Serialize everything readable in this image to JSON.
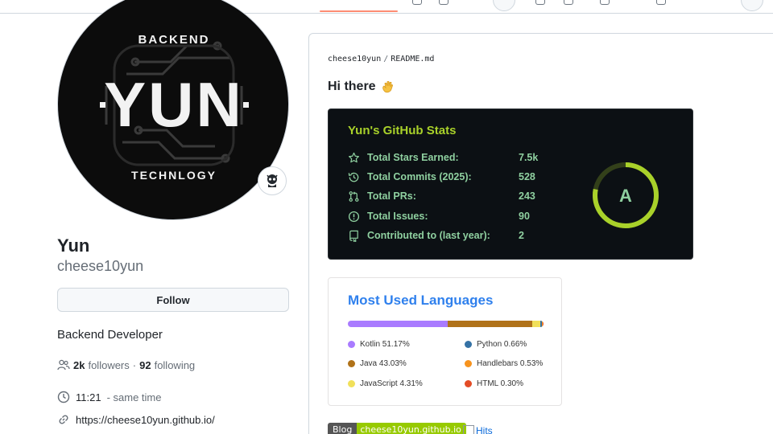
{
  "profile": {
    "display_name": "Yun",
    "login": "cheese10yun",
    "follow_label": "Follow",
    "bio": "Backend Developer",
    "followers_count": "2k",
    "followers_label": "followers",
    "separator": "·",
    "following_count": "92",
    "following_label": "following",
    "local_time": "11:21",
    "time_suffix": "- same time",
    "website": "https://cheese10yun.github.io/",
    "avatar_text": {
      "top": "BACKEND",
      "main": "YUN",
      "bottom": "TECHNLOGY"
    }
  },
  "readme": {
    "owner": "cheese10yun",
    "separator": "/",
    "file": "README.md",
    "greeting": "Hi there"
  },
  "stats": {
    "title": "Yun's GitHub Stats",
    "rows": [
      {
        "label": "Total Stars Earned:",
        "value": "7.5k",
        "icon": "star-icon"
      },
      {
        "label": "Total Commits (2025):",
        "value": "528",
        "icon": "history-icon"
      },
      {
        "label": "Total PRs:",
        "value": "243",
        "icon": "pull-request-icon"
      },
      {
        "label": "Total Issues:",
        "value": "90",
        "icon": "issue-icon"
      },
      {
        "label": "Contributed to (last year):",
        "value": "2",
        "icon": "repo-icon"
      }
    ],
    "rank": "A",
    "rank_progress": 0.78,
    "colors": {
      "title": "#a9d12a",
      "text": "#8fd0a0",
      "ring": "#a9d12a",
      "background": "#0c1014"
    }
  },
  "languages": {
    "title": "Most Used Languages",
    "items": [
      {
        "name": "Kotlin",
        "percent": 51.17,
        "label": "Kotlin 51.17%",
        "color": "#A97BFF"
      },
      {
        "name": "Java",
        "percent": 43.03,
        "label": "Java 43.03%",
        "color": "#b07219"
      },
      {
        "name": "JavaScript",
        "percent": 4.31,
        "label": "JavaScript 4.31%",
        "color": "#f1e05a"
      },
      {
        "name": "Python",
        "percent": 0.66,
        "label": "Python 0.66%",
        "color": "#3572A5"
      },
      {
        "name": "Handlebars",
        "percent": 0.53,
        "label": "Handlebars 0.53%",
        "color": "#f7931e"
      },
      {
        "name": "HTML",
        "percent": 0.3,
        "label": "HTML 0.30%",
        "color": "#e34c26"
      }
    ]
  },
  "badges": {
    "blog_label": "Blog",
    "blog_value": "cheese10yun.github.io",
    "hits_alt": "Hits"
  }
}
